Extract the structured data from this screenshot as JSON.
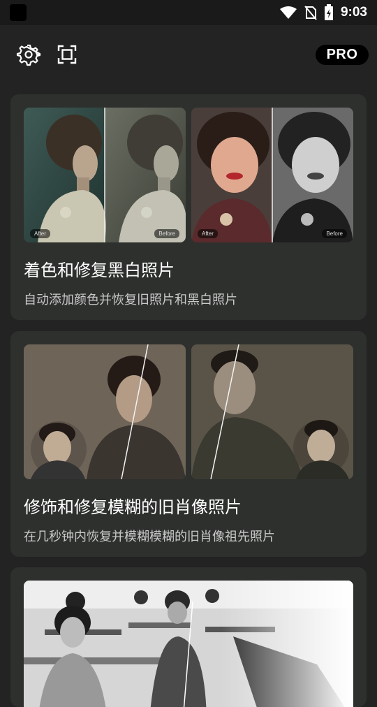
{
  "status_bar": {
    "time": "9:03",
    "icons": [
      "app-icon",
      "wifi-icon",
      "no-sim-icon",
      "battery-icon"
    ]
  },
  "toolbar": {
    "icons": [
      "gear-icon",
      "scan-icon"
    ],
    "pro_label": "PRO"
  },
  "features": [
    {
      "title": "着色和修复黑白照片",
      "description": "自动添加颜色并恢复旧照片和黑白照片",
      "compare_labels": {
        "after": "After",
        "before": "Before"
      }
    },
    {
      "title": "修饰和修复模糊的旧肖像照片",
      "description": "在几秒钟内恢复并模糊模糊的旧肖像祖先照片"
    }
  ],
  "colors": {
    "background": "#222322",
    "card": "#2e302e",
    "status_bar": "#191a19",
    "pro_badge": "#000000"
  }
}
